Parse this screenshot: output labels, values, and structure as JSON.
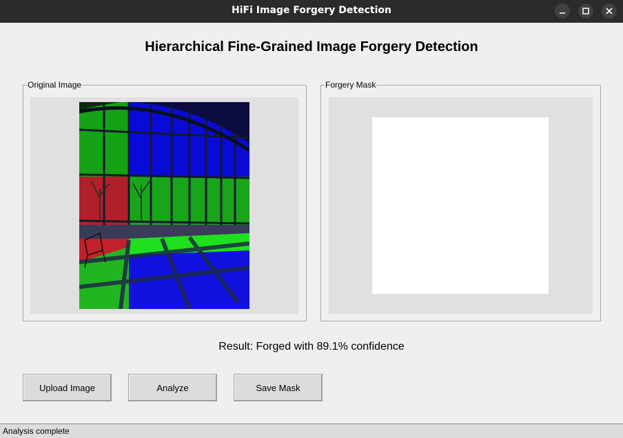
{
  "window": {
    "title": "HiFi Image Forgery Detection",
    "controls": [
      "minimize-icon",
      "maximize-icon",
      "close-icon"
    ]
  },
  "header": {
    "title": "Hierarchical Fine-Grained Image Forgery Detection"
  },
  "panels": {
    "original": {
      "label": "Original Image"
    },
    "mask": {
      "label": "Forgery Mask"
    }
  },
  "result": {
    "text": "Result: Forged with 89.1% confidence"
  },
  "buttons": {
    "upload": "Upload Image",
    "analyze": "Analyze",
    "save": "Save Mask"
  },
  "status": {
    "text": "Analysis complete"
  },
  "colors": {
    "titlebar": "#2b2b2b",
    "window_bg": "#efefef",
    "canvas_bg": "#e0e0e0",
    "mask_fill": "#ffffff",
    "overlay_red": "#c8202a",
    "overlay_green": "#22e022",
    "overlay_blue": "#1818f0"
  }
}
